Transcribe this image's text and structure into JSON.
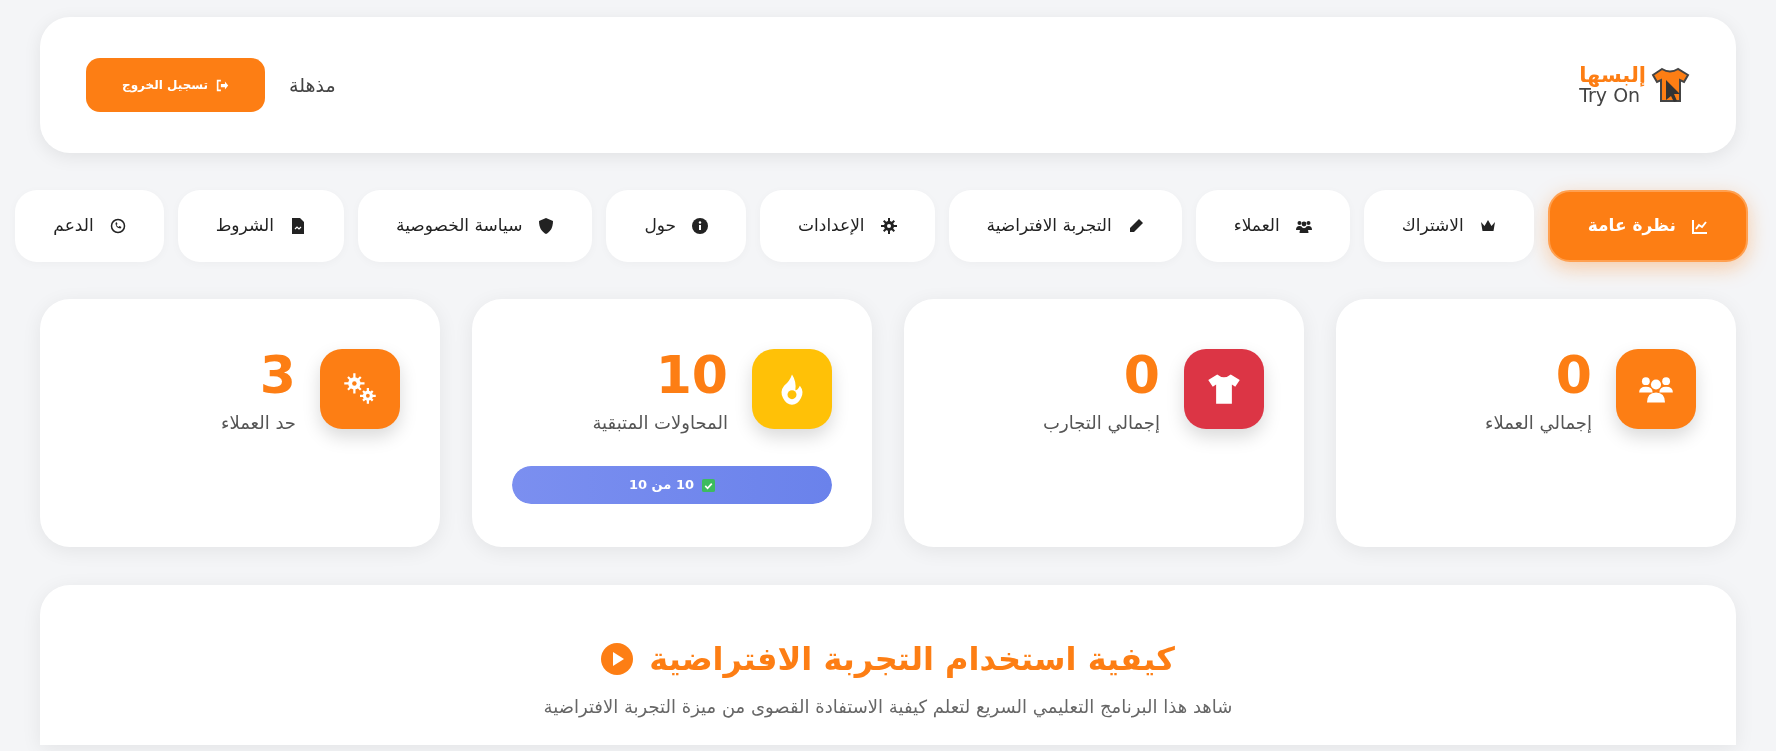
{
  "header": {
    "logo": {
      "brand": "إلبسها",
      "tagline": "Try On"
    },
    "user_name": "مذهلة",
    "logout_button": "تسجيل الخروج"
  },
  "nav": [
    {
      "label": "نظرة عامة",
      "selected": true
    },
    {
      "label": "الاشتراك",
      "selected": false
    },
    {
      "label": "العملاء",
      "selected": false
    },
    {
      "label": "التجربة الافتراضية",
      "selected": false
    },
    {
      "label": "الإعدادات",
      "selected": false
    },
    {
      "label": "حول",
      "selected": false
    },
    {
      "label": "سياسة الخصوصية",
      "selected": false
    },
    {
      "label": "الشروط",
      "selected": false
    },
    {
      "label": "الدعم",
      "selected": false
    }
  ],
  "stats": [
    {
      "value": "0",
      "label": "إجمالي العملاء",
      "color": "#fd7e14"
    },
    {
      "value": "0",
      "label": "إجمالي التجارب",
      "color": "#dc3545"
    },
    {
      "value": "10",
      "label": "المحاولات المتبقية",
      "color": "#ffc107",
      "progress": {
        "level": 1,
        "text": "10 من 10"
      }
    },
    {
      "value": "3",
      "label": "حد العملاء",
      "color": "#fd7e14"
    }
  ],
  "tutorial": {
    "title": "كيفية استخدام التجربة الافتراضية",
    "subtitle": "شاهد هذا البرنامج التعليمي السريع لتعلم كيفية الاستفادة القصوى من ميزة التجربة الافتراضية"
  }
}
